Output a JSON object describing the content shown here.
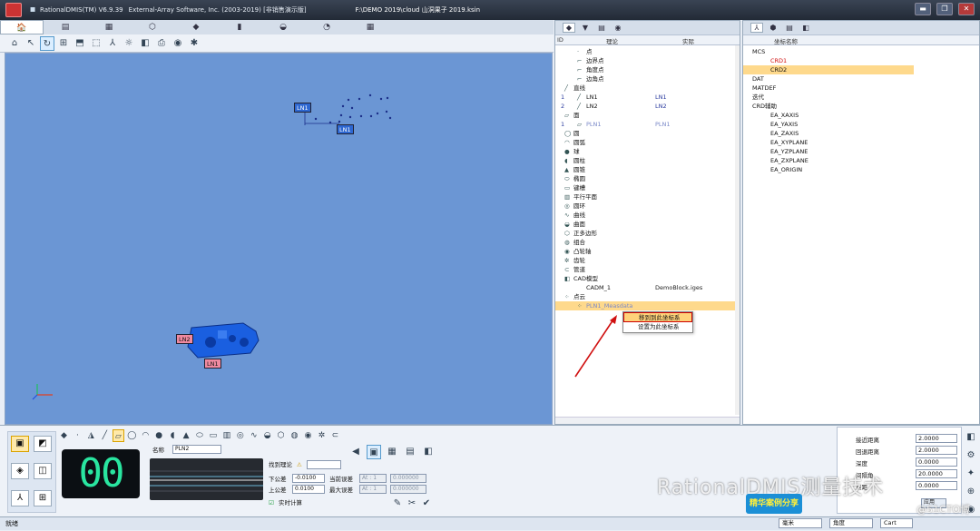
{
  "title": {
    "app": "RationalDMIS(TM) V6.9.39",
    "company": "External-Array Software, Inc. (2003-2019) [非销售演示版]",
    "path": "F:\\DEMO 2019\\cloud 山洞果子 2019.ksin"
  },
  "viewport": {
    "labels": [
      "LN1",
      "LN1",
      "LN2",
      "LN1"
    ]
  },
  "feature_panel": {
    "col_id": "ID",
    "col_nominal": "理论",
    "col_actual": "实际",
    "rows": [
      {
        "id": "",
        "name": "点"
      },
      {
        "id": "",
        "name": "边界点"
      },
      {
        "id": "",
        "name": "角度点"
      },
      {
        "id": "",
        "name": "边角点"
      },
      {
        "id": "",
        "name": "直线"
      },
      {
        "id": "1",
        "name": "LN1",
        "actual": "LN1"
      },
      {
        "id": "2",
        "name": "LN2",
        "actual": "LN2"
      },
      {
        "id": "",
        "name": "面"
      },
      {
        "id": "1",
        "name": "PLN1",
        "actual": "PLN1"
      },
      {
        "id": "",
        "name": "圆"
      },
      {
        "id": "",
        "name": "圆弧"
      },
      {
        "id": "",
        "name": "球"
      },
      {
        "id": "",
        "name": "圆柱"
      },
      {
        "id": "",
        "name": "圆锥"
      },
      {
        "id": "",
        "name": "椭圆"
      },
      {
        "id": "",
        "name": "键槽"
      },
      {
        "id": "",
        "name": "平行平面"
      },
      {
        "id": "",
        "name": "圆环"
      },
      {
        "id": "",
        "name": "曲线"
      },
      {
        "id": "",
        "name": "曲面"
      },
      {
        "id": "",
        "name": "正多边形"
      },
      {
        "id": "",
        "name": "组合"
      },
      {
        "id": "",
        "name": "凸轮轴"
      },
      {
        "id": "",
        "name": "齿轮"
      },
      {
        "id": "",
        "name": "管道"
      },
      {
        "id": "",
        "name": "CAD模型"
      },
      {
        "id": "",
        "name": "CADM_1",
        "actual": "DemoBlock.iges"
      },
      {
        "id": "",
        "name": "点云"
      },
      {
        "id": "",
        "name": "PLN1_Measdata"
      }
    ],
    "context_menu": [
      "移到到此坐标系",
      "设置为此坐标系"
    ]
  },
  "coord_panel": {
    "header": "坐标名称",
    "rows": [
      "MCS",
      "CRD1",
      "CRD2",
      "DAT",
      "MATDEF",
      "迭代",
      "CRD辅助",
      "EA_XAXIS",
      "EA_YAXIS",
      "EA_ZAXIS",
      "EA_XYPLANE",
      "EA_YZPLANE",
      "EA_ZXPLANE",
      "EA_ORIGIN"
    ]
  },
  "measure": {
    "count": "00",
    "name_label": "名称",
    "name_value": "PLN2",
    "find_nominal": "找到理论",
    "lower_tol_label": "下公差",
    "lower_tol": "-0.0100",
    "upper_tol_label": "上公差",
    "upper_tol": "0.0100",
    "cur_err_label": "当前误差",
    "cur_err": [
      "At : 1",
      "0.000000"
    ],
    "max_err_label": "最大误差",
    "max_err": [
      "At : 1",
      "0.000000"
    ],
    "realtime": "实时计算"
  },
  "params": [
    {
      "label": "接近距离",
      "value": "2.0000"
    },
    {
      "label": "回退距离",
      "value": "2.0000"
    },
    {
      "label": "深度",
      "value": "0.0000"
    },
    {
      "label": "间隔角",
      "value": "20.0000"
    },
    {
      "label": "点距",
      "value": "0.0000"
    }
  ],
  "apply": "应用",
  "status": {
    "ready": "就绪",
    "units": [
      "毫米",
      "角度",
      "Cart"
    ]
  },
  "watermark": "RationalDMIS测量技术",
  "watermark2": "@51CTO博客",
  "banner": "精华案例分享"
}
